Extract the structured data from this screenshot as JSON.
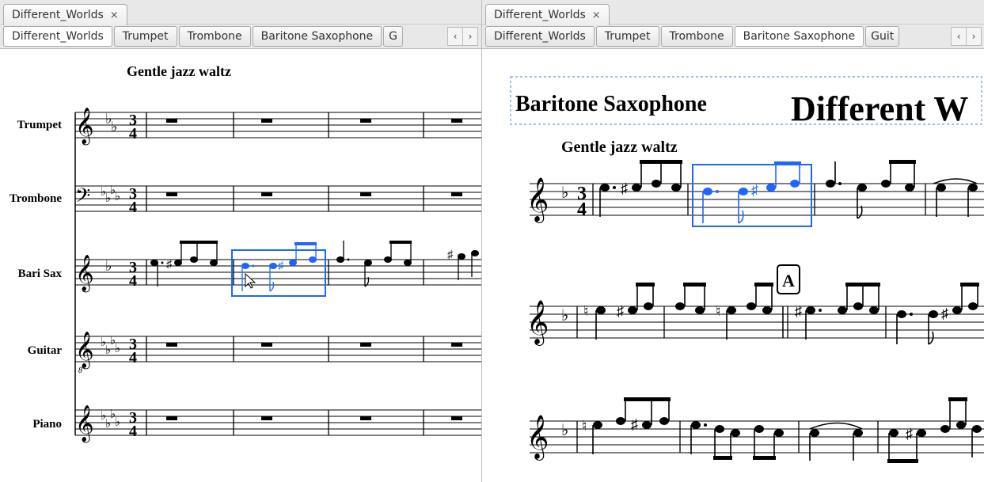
{
  "left": {
    "file_tab": {
      "label": "Different_Worlds",
      "close": "×"
    },
    "part_tabs": [
      "Different_Worlds",
      "Trumpet",
      "Trombone",
      "Baritone Saxophone"
    ],
    "part_tab_trunc_hint": "G",
    "active_part_index": 0,
    "tempo_text": "Gentle jazz waltz",
    "instruments": [
      "Trumpet",
      "Trombone",
      "Bari Sax",
      "Guitar",
      "Piano"
    ],
    "time_signature": {
      "num": "3",
      "den": "4"
    }
  },
  "right": {
    "file_tab": {
      "label": "Different_Worlds",
      "close": "×"
    },
    "part_tabs": [
      "Different_Worlds",
      "Trumpet",
      "Trombone",
      "Baritone Saxophone"
    ],
    "part_tab_trunc_hint": "Guit",
    "active_part_index": 3,
    "part_heading": "Baritone Saxophone",
    "title_fragment": "Different W",
    "tempo_text": "Gentle jazz waltz",
    "rehearsal_mark": "A",
    "time_signature": {
      "num": "3",
      "den": "4"
    }
  },
  "colors": {
    "selection": "#1e66ff",
    "tab_bg": "#e8e8e8"
  }
}
